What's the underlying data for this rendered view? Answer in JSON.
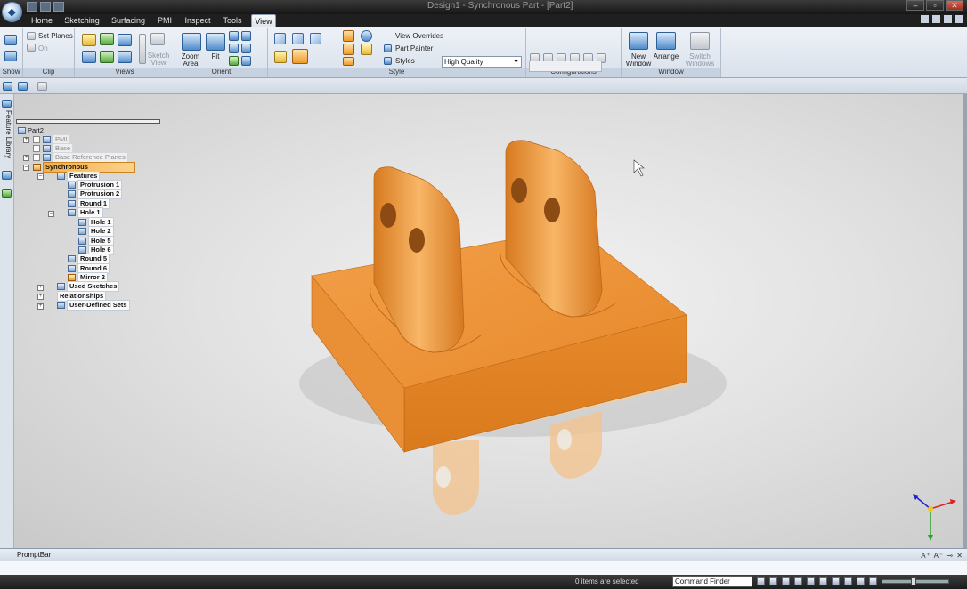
{
  "window": {
    "title": "Design1 - Synchronous Part - [Part2]"
  },
  "tabs": [
    {
      "label": "Home"
    },
    {
      "label": "Sketching"
    },
    {
      "label": "Surfacing"
    },
    {
      "label": "PMI"
    },
    {
      "label": "Inspect"
    },
    {
      "label": "Tools"
    },
    {
      "label": "View"
    }
  ],
  "ribbon": {
    "show": {
      "label": "Show"
    },
    "clip": {
      "label": "Clip",
      "set_planes": "Set Planes",
      "on": "On"
    },
    "views": {
      "label": "Views",
      "sketch_view": "Sketch View"
    },
    "orient": {
      "label": "Orient",
      "zoom_area": "Zoom Area",
      "fit": "Fit"
    },
    "style": {
      "label": "Style",
      "view_overrides": "View Overrides",
      "quality": "High Quality",
      "part_painter": "Part Painter",
      "styles": "Styles"
    },
    "configurations": {
      "label": "Configurations"
    },
    "window": {
      "label": "Window",
      "new_window": "New Window",
      "arrange": "Arrange",
      "switch_windows": "Switch Windows"
    }
  },
  "sidebar": {
    "feature_library": "Feature Library"
  },
  "tree": {
    "root": "Part2",
    "pmi": "PMI",
    "base": "Base",
    "base_reference_planes": "Base Reference Planes",
    "synchronous": "Synchronous",
    "features": "Features",
    "protrusion_1": "Protrusion 1",
    "protrusion_2": "Protrusion 2",
    "round_1": "Round 1",
    "hole_1_group": "Hole 1",
    "hole_1": "Hole 1",
    "hole_2": "Hole 2",
    "hole_5": "Hole 5",
    "hole_6": "Hole 6",
    "round_5": "Round 5",
    "round_6": "Round 6",
    "mirror_2": "Mirror 2",
    "used_sketches": "Used Sketches",
    "relationships": "Relationships",
    "user_defined_sets": "User-Defined Sets"
  },
  "promptbar": {
    "title": "PromptBar"
  },
  "status": {
    "selection": "0 items are selected",
    "command_finder": "Command Finder"
  },
  "colors": {
    "part": "#f0902c",
    "accent": "#f5b04a"
  }
}
